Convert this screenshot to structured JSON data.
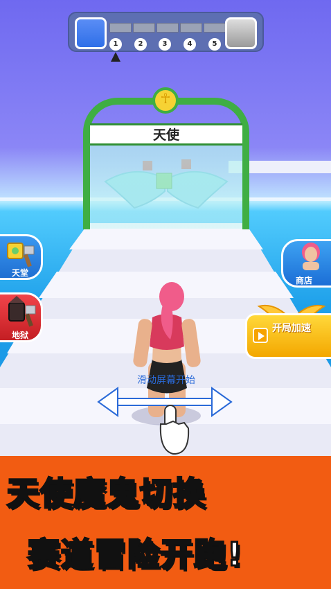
{
  "progress": {
    "steps": [
      "1",
      "2",
      "3",
      "4",
      "5"
    ],
    "current_step": 1
  },
  "gate": {
    "label": "天使",
    "emblem": "☥"
  },
  "side_buttons": {
    "heaven_label": "天堂",
    "hell_label": "地狱",
    "shop_label": "商店",
    "speed_label": "开局加速"
  },
  "swipe_hint": "滑动屏幕开始",
  "banner": {
    "line1": "天使魔鬼切换",
    "line2": "赛道冒险开跑!"
  },
  "colors": {
    "banner_bg": "#f25c12",
    "gate_green": "#3fae43",
    "blue_button": "#1f6fd2",
    "red_button": "#c41e23",
    "yellow_button": "#f3a700"
  }
}
